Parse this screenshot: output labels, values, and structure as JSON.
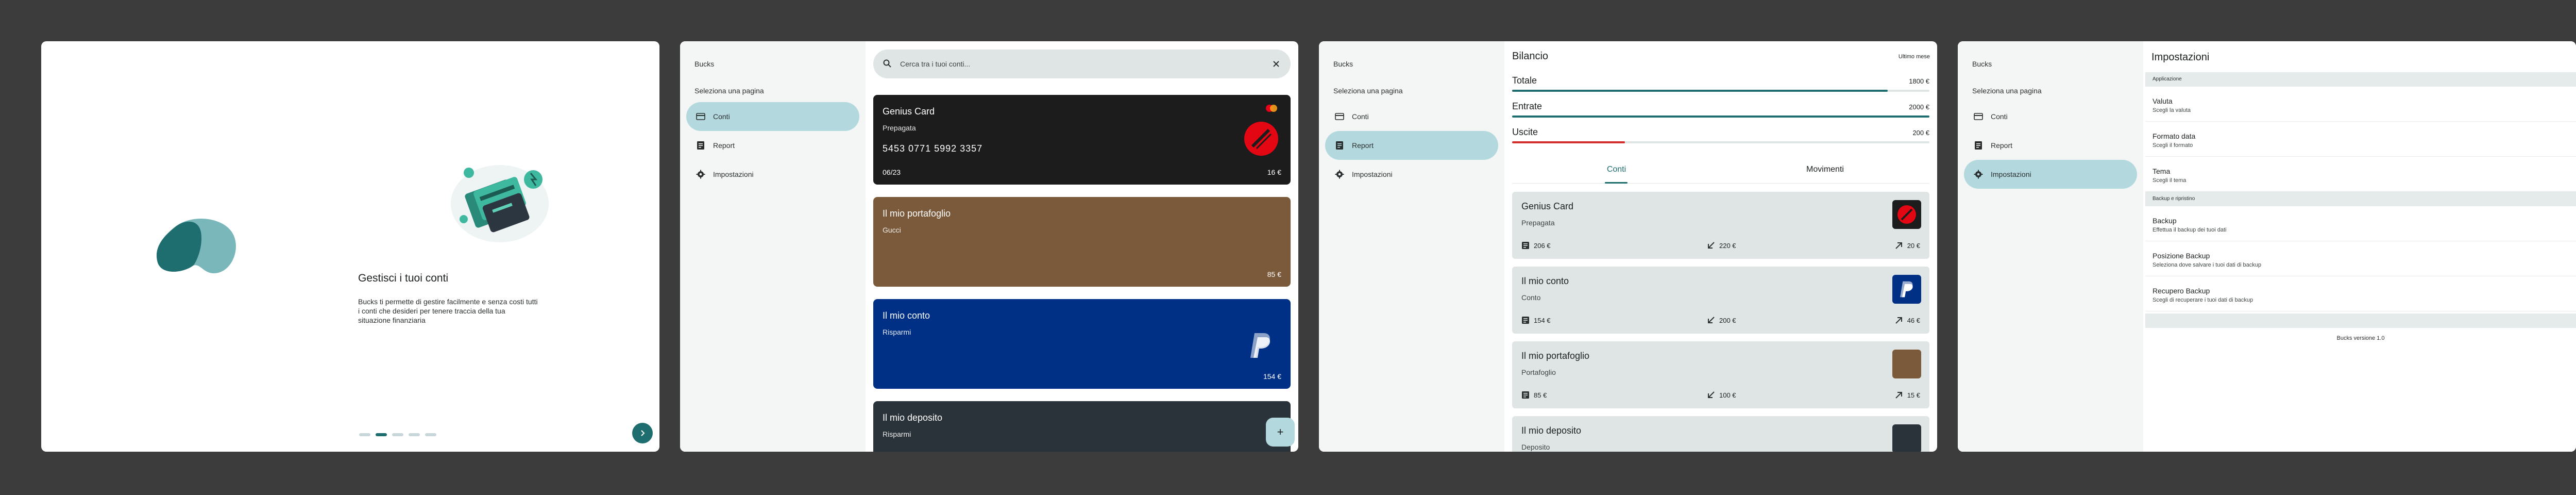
{
  "colors": {
    "background": "#3c3c3c",
    "accent": "#1f6e6f",
    "active_nav": "#b3d9df",
    "card_genius": "#1c1c1c",
    "card_portafoglio": "#7a5a3a",
    "card_conto": "#003086",
    "card_deposito": "#2b333a",
    "bar_totale": "#1f6e6f",
    "bar_entrate": "#1f6e6f",
    "bar_uscite": "#d32f2f"
  },
  "sidebar": {
    "app_name": "Bucks",
    "subtitle": "Seleziona una pagina",
    "items": [
      {
        "label": "Conti",
        "icon": "credit-card-icon"
      },
      {
        "label": "Report",
        "icon": "receipt-icon"
      },
      {
        "label": "Impostazioni",
        "icon": "gear-icon"
      }
    ]
  },
  "onboarding": {
    "title": "Gestisci i tuoi conti",
    "text": "Bucks ti permette di gestire facilmente e senza costi tutti i conti che desideri per tenere traccia della tua situazione finanziaria",
    "page_count": 5,
    "active_page": 2
  },
  "conti": {
    "search_placeholder": "Cerca tra i tuoi conti...",
    "cards": [
      {
        "name": "Genius Card",
        "type": "Prepagata",
        "number": "5453 0771 5992 3357",
        "expiry": "06/23",
        "balance": "16 €"
      },
      {
        "name": "Il mio portafoglio",
        "type": "Gucci",
        "balance": "85 €"
      },
      {
        "name": "Il mio conto",
        "type": "Risparmi",
        "balance": "154 €"
      },
      {
        "name": "Il mio deposito",
        "type": "Risparmi"
      }
    ],
    "fab_label": "+"
  },
  "report": {
    "title": "Bilancio",
    "period": "Ultimo mese",
    "rows": [
      {
        "label": "Totale",
        "value": "1800 €",
        "fill": 0.9
      },
      {
        "label": "Entrate",
        "value": "2000 €",
        "fill": 1.0
      },
      {
        "label": "Uscite",
        "value": "200 €",
        "fill": 0.27
      }
    ],
    "tabs": [
      "Conti",
      "Movimenti"
    ],
    "accounts": [
      {
        "name": "Genius Card",
        "type": "Prepagata",
        "balance": "206 €",
        "in": "220 €",
        "out": "20 €"
      },
      {
        "name": "Il mio conto",
        "type": "Conto",
        "balance": "154 €",
        "in": "200 €",
        "out": "46 €"
      },
      {
        "name": "Il mio portafoglio",
        "type": "Portafoglio",
        "balance": "85 €",
        "in": "100 €",
        "out": "15 €"
      },
      {
        "name": "Il mio deposito",
        "type": "Deposito"
      }
    ]
  },
  "settings": {
    "title": "Impostazioni",
    "section_app": "Applicazione",
    "section_backup": "Backup e ripristino",
    "items": [
      {
        "title": "Valuta",
        "desc": "Scegli la valuta"
      },
      {
        "title": "Formato data",
        "desc": "Scegli il formato"
      },
      {
        "title": "Tema",
        "desc": "Scegli il tema"
      },
      {
        "title": "Backup",
        "desc": "Effettua il backup dei tuoi dati"
      },
      {
        "title": "Posizione Backup",
        "desc": "Seleziona dove salvare i tuoi dati di backup"
      },
      {
        "title": "Recupero Backup",
        "desc": "Scegli di recuperare i tuoi dati di backup"
      }
    ],
    "version": "Bucks versione 1.0"
  }
}
